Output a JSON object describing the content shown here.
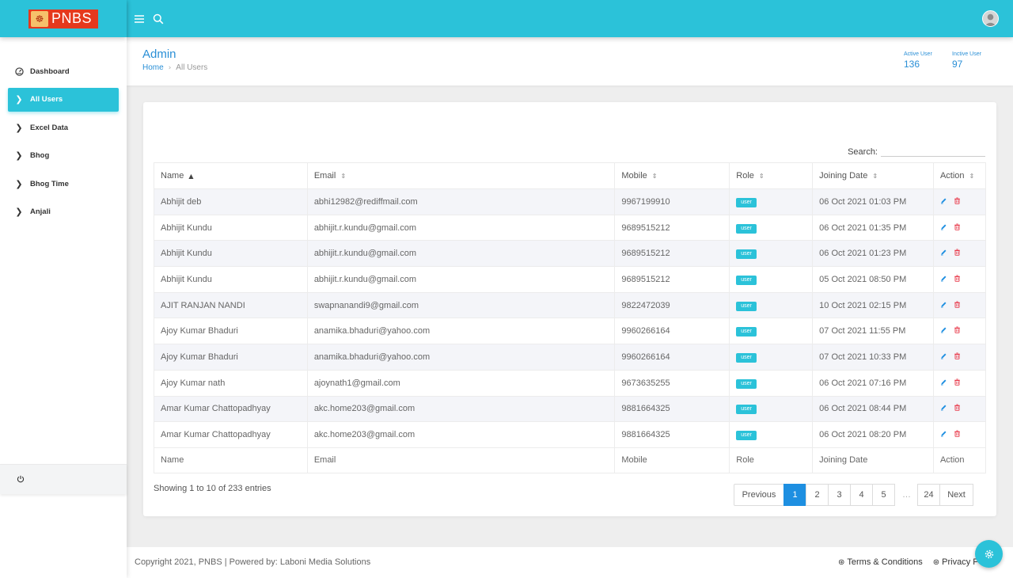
{
  "brand": {
    "name": "PNBS",
    "emblem_icon": "deity-emblem-icon"
  },
  "sidebar": {
    "items": [
      {
        "label": "Dashboard",
        "icon": "dashboard-icon"
      },
      {
        "label": "All Users",
        "icon": "chevron-right-icon"
      },
      {
        "label": "Excel Data",
        "icon": "chevron-right-icon"
      },
      {
        "label": "Bhog",
        "icon": "chevron-right-icon"
      },
      {
        "label": "Bhog Time",
        "icon": "chevron-right-icon"
      },
      {
        "label": "Anjali",
        "icon": "chevron-right-icon"
      }
    ],
    "active_index": 1,
    "bottom_icon": "power-icon"
  },
  "topbar": {
    "menu_icon": "hamburger-icon",
    "search_icon": "search-icon",
    "avatar_icon": "user-avatar-icon"
  },
  "header": {
    "title": "Admin",
    "breadcrumb": {
      "home": "Home",
      "current": "All Users"
    },
    "stats": {
      "active": {
        "label": "Active User",
        "value": "136"
      },
      "inactive": {
        "label": "Inctive User",
        "value": "97"
      }
    }
  },
  "table": {
    "search_label": "Search:",
    "search_value": "",
    "columns": [
      "Name",
      "Email",
      "Mobile",
      "Role",
      "Joining Date",
      "Action"
    ],
    "rows": [
      {
        "name": "Abhijit deb",
        "email": "abhi12982@rediffmail.com",
        "mobile": "9967199910",
        "role": "user",
        "date": "06 Oct 2021 01:03 PM"
      },
      {
        "name": "Abhijit Kundu",
        "email": "abhijit.r.kundu@gmail.com",
        "mobile": "9689515212",
        "role": "user",
        "date": "06 Oct 2021 01:35 PM"
      },
      {
        "name": "Abhijit Kundu",
        "email": "abhijit.r.kundu@gmail.com",
        "mobile": "9689515212",
        "role": "user",
        "date": "06 Oct 2021 01:23 PM"
      },
      {
        "name": "Abhijit Kundu",
        "email": "abhijit.r.kundu@gmail.com",
        "mobile": "9689515212",
        "role": "user",
        "date": "05 Oct 2021 08:50 PM"
      },
      {
        "name": "AJIT RANJAN NANDI",
        "email": "swapnanandi9@gmail.com",
        "mobile": "9822472039",
        "role": "user",
        "date": "10 Oct 2021 02:15 PM"
      },
      {
        "name": "Ajoy Kumar Bhaduri",
        "email": "anamika.bhaduri@yahoo.com",
        "mobile": "9960266164",
        "role": "user",
        "date": "07 Oct 2021 11:55 PM"
      },
      {
        "name": "Ajoy Kumar Bhaduri",
        "email": "anamika.bhaduri@yahoo.com",
        "mobile": "9960266164",
        "role": "user",
        "date": "07 Oct 2021 10:33 PM"
      },
      {
        "name": "Ajoy Kumar nath",
        "email": "ajoynath1@gmail.com",
        "mobile": "9673635255",
        "role": "user",
        "date": "06 Oct 2021 07:16 PM"
      },
      {
        "name": "Amar Kumar Chattopadhyay",
        "email": "akc.home203@gmail.com",
        "mobile": "9881664325",
        "role": "user",
        "date": "06 Oct 2021 08:44 PM"
      },
      {
        "name": "Amar Kumar Chattopadhyay",
        "email": "akc.home203@gmail.com",
        "mobile": "9881664325",
        "role": "user",
        "date": "06 Oct 2021 08:20 PM"
      }
    ],
    "action_icons": [
      "edit-icon",
      "delete-icon"
    ],
    "showing": "Showing 1 to 10 of 233 entries"
  },
  "pagination": {
    "previous": "Previous",
    "pages": [
      "1",
      "2",
      "3",
      "4",
      "5"
    ],
    "ellipsis": "…",
    "last": "24",
    "next": "Next",
    "current": "1"
  },
  "footer": {
    "copyright": "Copyright 2021, PNBS | Powered by: Laboni Media Solutions",
    "links": [
      "Terms & Conditions",
      "Privacy P"
    ]
  },
  "colors": {
    "primary": "#2bc2d9",
    "link": "#2a8fd6",
    "page_active": "#1e8fe1",
    "edit": "#1e8fe1",
    "delete": "#e8394a"
  },
  "fab_icon": "settings-gear-icon"
}
